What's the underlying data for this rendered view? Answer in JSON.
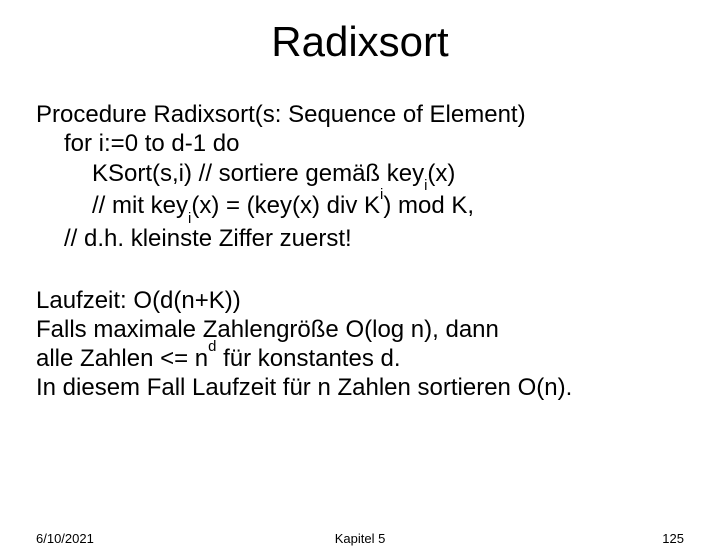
{
  "title": "Radixsort",
  "proc": {
    "l1a": "Procedure Radixsort(s: Sequence of Element)",
    "l2a": "for i:=0 to d-1 do",
    "l3a": "KSort(s,i)   // sortiere gemäß key",
    "l3b": "(x)",
    "l4a": "// mit key",
    "l4b": "(x) = (key(x) div K",
    "l4c": ") mod K,",
    "l5a": "// d.h. kleinste Ziffer zuerst!",
    "sub_i1": "i",
    "sub_i2": "i",
    "sup_i": "i"
  },
  "run": {
    "r1": "Laufzeit: O(d(n+K))",
    "r2": "Falls maximale Zahlengröße O(log n), dann",
    "r3a": "alle Zahlen <= n",
    "r3b": " für konstantes d.",
    "sup_d": "d",
    "r4": "In diesem Fall Laufzeit für n Zahlen sortieren O(n)."
  },
  "footer": {
    "date": "6/10/2021",
    "chapter": "Kapitel 5",
    "page": "125"
  }
}
